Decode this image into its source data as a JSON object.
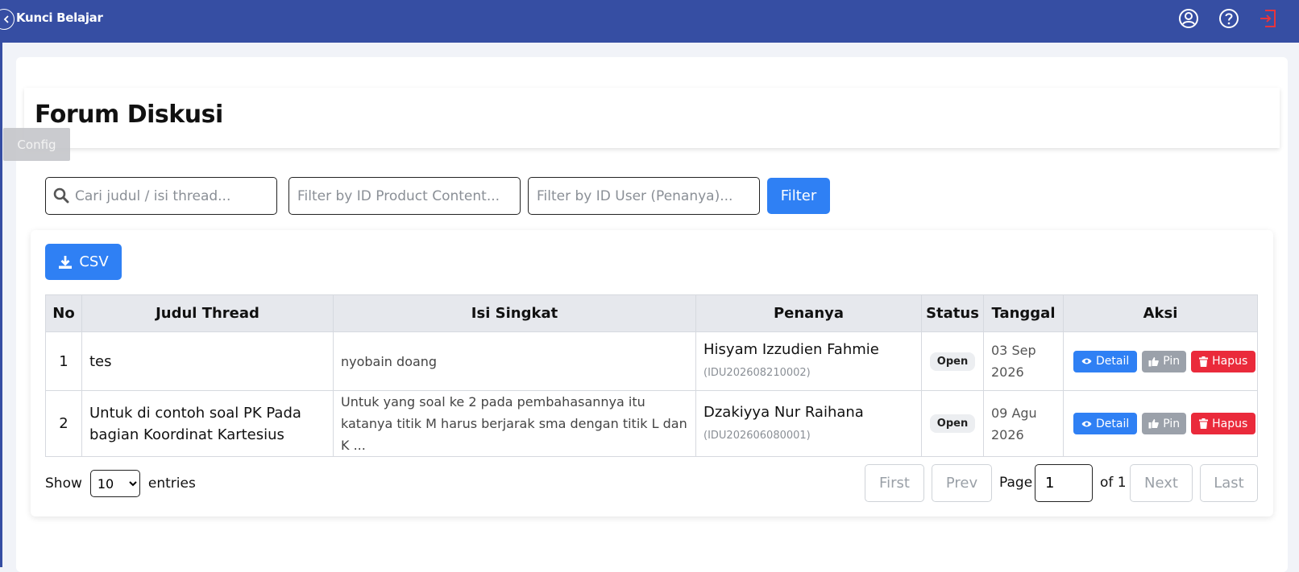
{
  "header": {
    "title": "Kunci Belajar",
    "icons": [
      "back-icon",
      "user-circle-icon",
      "help-circle-icon",
      "logout-icon"
    ],
    "logout_color": "#e8343c"
  },
  "page": {
    "title": "Forum Diskusi"
  },
  "config_tab": "Config",
  "filters": {
    "search_placeholder": "Cari judul / isi thread...",
    "product_placeholder": "Filter by ID Product Content...",
    "user_placeholder": "Filter by ID User (Penanya)...",
    "button": "Filter"
  },
  "csv_button": "CSV",
  "table": {
    "headers": [
      "No",
      "Judul Thread",
      "Isi Singkat",
      "Penanya",
      "Status",
      "Tanggal",
      "Aksi"
    ],
    "rows": [
      {
        "no": "1",
        "judul": "tes",
        "isi": "nyobain doang",
        "penanya": "Hisyam Izzudien Fahmie",
        "user_id": "(IDU202608210002)",
        "status": "Open",
        "tanggal": "03 Sep 2026"
      },
      {
        "no": "2",
        "judul": "Untuk di contoh soal PK Pada bagian Koordinat Kartesius",
        "isi": "Untuk yang soal ke 2 pada pembahasannya itu katanya titik M harus berjarak sma dengan titik L dan K ...",
        "penanya": "Dzakiyya Nur Raihana",
        "user_id": "(IDU202606080001)",
        "status": "Open",
        "tanggal": "09 Agu 2026"
      }
    ],
    "actions": {
      "detail": "Detail",
      "pin": "Pin",
      "hapus": "Hapus"
    }
  },
  "footer": {
    "show_label": "Show",
    "entries_label": "entries",
    "entries_value": "10",
    "first": "First",
    "prev": "Prev",
    "page_label": "Page",
    "page_value": "1",
    "of_label": "of 1",
    "next": "Next",
    "last": "Last"
  },
  "colors": {
    "header_bg": "#364ea3",
    "primary": "#2f80f4",
    "danger": "#ea2a3b",
    "muted": "#9ba1aa"
  }
}
